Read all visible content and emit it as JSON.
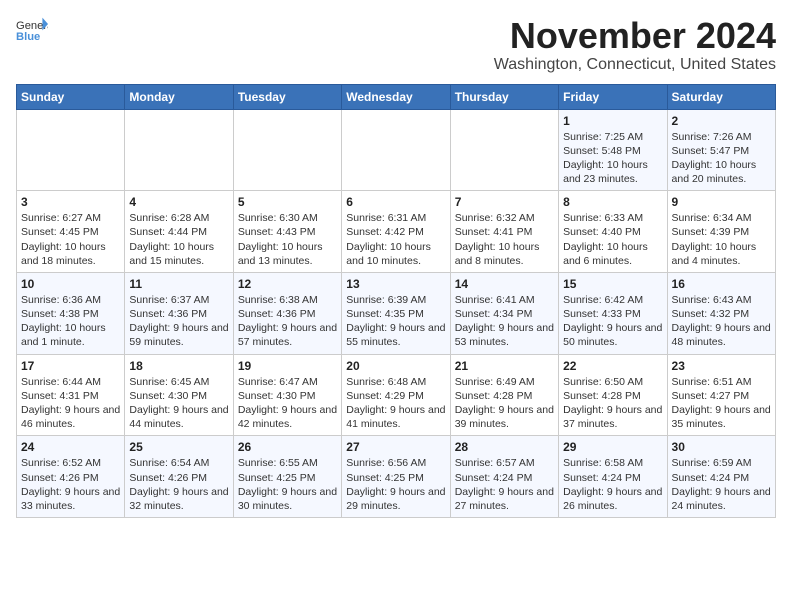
{
  "header": {
    "logo_general": "General",
    "logo_blue": "Blue",
    "month": "November 2024",
    "location": "Washington, Connecticut, United States"
  },
  "weekdays": [
    "Sunday",
    "Monday",
    "Tuesday",
    "Wednesday",
    "Thursday",
    "Friday",
    "Saturday"
  ],
  "weeks": [
    [
      {
        "day": "",
        "info": ""
      },
      {
        "day": "",
        "info": ""
      },
      {
        "day": "",
        "info": ""
      },
      {
        "day": "",
        "info": ""
      },
      {
        "day": "",
        "info": ""
      },
      {
        "day": "1",
        "info": "Sunrise: 7:25 AM\nSunset: 5:48 PM\nDaylight: 10 hours and 23 minutes."
      },
      {
        "day": "2",
        "info": "Sunrise: 7:26 AM\nSunset: 5:47 PM\nDaylight: 10 hours and 20 minutes."
      }
    ],
    [
      {
        "day": "3",
        "info": "Sunrise: 6:27 AM\nSunset: 4:45 PM\nDaylight: 10 hours and 18 minutes."
      },
      {
        "day": "4",
        "info": "Sunrise: 6:28 AM\nSunset: 4:44 PM\nDaylight: 10 hours and 15 minutes."
      },
      {
        "day": "5",
        "info": "Sunrise: 6:30 AM\nSunset: 4:43 PM\nDaylight: 10 hours and 13 minutes."
      },
      {
        "day": "6",
        "info": "Sunrise: 6:31 AM\nSunset: 4:42 PM\nDaylight: 10 hours and 10 minutes."
      },
      {
        "day": "7",
        "info": "Sunrise: 6:32 AM\nSunset: 4:41 PM\nDaylight: 10 hours and 8 minutes."
      },
      {
        "day": "8",
        "info": "Sunrise: 6:33 AM\nSunset: 4:40 PM\nDaylight: 10 hours and 6 minutes."
      },
      {
        "day": "9",
        "info": "Sunrise: 6:34 AM\nSunset: 4:39 PM\nDaylight: 10 hours and 4 minutes."
      }
    ],
    [
      {
        "day": "10",
        "info": "Sunrise: 6:36 AM\nSunset: 4:38 PM\nDaylight: 10 hours and 1 minute."
      },
      {
        "day": "11",
        "info": "Sunrise: 6:37 AM\nSunset: 4:36 PM\nDaylight: 9 hours and 59 minutes."
      },
      {
        "day": "12",
        "info": "Sunrise: 6:38 AM\nSunset: 4:36 PM\nDaylight: 9 hours and 57 minutes."
      },
      {
        "day": "13",
        "info": "Sunrise: 6:39 AM\nSunset: 4:35 PM\nDaylight: 9 hours and 55 minutes."
      },
      {
        "day": "14",
        "info": "Sunrise: 6:41 AM\nSunset: 4:34 PM\nDaylight: 9 hours and 53 minutes."
      },
      {
        "day": "15",
        "info": "Sunrise: 6:42 AM\nSunset: 4:33 PM\nDaylight: 9 hours and 50 minutes."
      },
      {
        "day": "16",
        "info": "Sunrise: 6:43 AM\nSunset: 4:32 PM\nDaylight: 9 hours and 48 minutes."
      }
    ],
    [
      {
        "day": "17",
        "info": "Sunrise: 6:44 AM\nSunset: 4:31 PM\nDaylight: 9 hours and 46 minutes."
      },
      {
        "day": "18",
        "info": "Sunrise: 6:45 AM\nSunset: 4:30 PM\nDaylight: 9 hours and 44 minutes."
      },
      {
        "day": "19",
        "info": "Sunrise: 6:47 AM\nSunset: 4:30 PM\nDaylight: 9 hours and 42 minutes."
      },
      {
        "day": "20",
        "info": "Sunrise: 6:48 AM\nSunset: 4:29 PM\nDaylight: 9 hours and 41 minutes."
      },
      {
        "day": "21",
        "info": "Sunrise: 6:49 AM\nSunset: 4:28 PM\nDaylight: 9 hours and 39 minutes."
      },
      {
        "day": "22",
        "info": "Sunrise: 6:50 AM\nSunset: 4:28 PM\nDaylight: 9 hours and 37 minutes."
      },
      {
        "day": "23",
        "info": "Sunrise: 6:51 AM\nSunset: 4:27 PM\nDaylight: 9 hours and 35 minutes."
      }
    ],
    [
      {
        "day": "24",
        "info": "Sunrise: 6:52 AM\nSunset: 4:26 PM\nDaylight: 9 hours and 33 minutes."
      },
      {
        "day": "25",
        "info": "Sunrise: 6:54 AM\nSunset: 4:26 PM\nDaylight: 9 hours and 32 minutes."
      },
      {
        "day": "26",
        "info": "Sunrise: 6:55 AM\nSunset: 4:25 PM\nDaylight: 9 hours and 30 minutes."
      },
      {
        "day": "27",
        "info": "Sunrise: 6:56 AM\nSunset: 4:25 PM\nDaylight: 9 hours and 29 minutes."
      },
      {
        "day": "28",
        "info": "Sunrise: 6:57 AM\nSunset: 4:24 PM\nDaylight: 9 hours and 27 minutes."
      },
      {
        "day": "29",
        "info": "Sunrise: 6:58 AM\nSunset: 4:24 PM\nDaylight: 9 hours and 26 minutes."
      },
      {
        "day": "30",
        "info": "Sunrise: 6:59 AM\nSunset: 4:24 PM\nDaylight: 9 hours and 24 minutes."
      }
    ]
  ]
}
